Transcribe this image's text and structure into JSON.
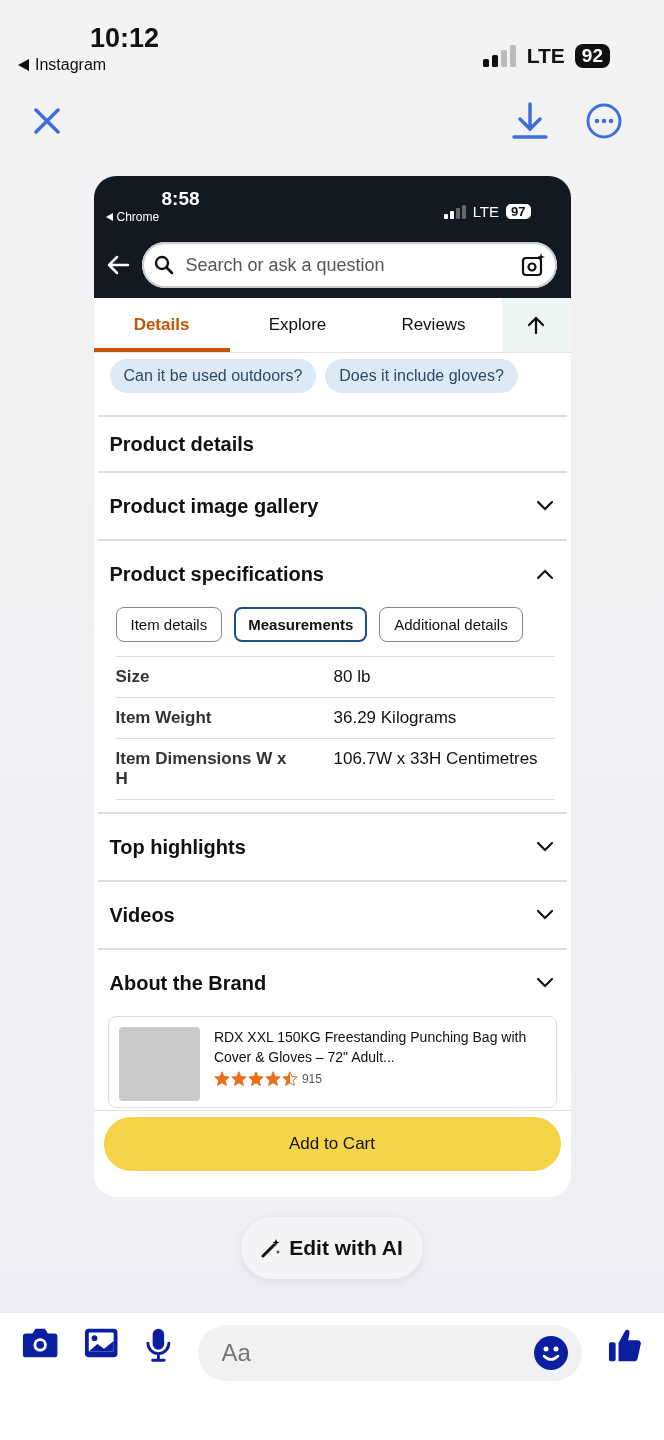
{
  "status_bar": {
    "time": "10:12",
    "back_label": "Instagram",
    "network": "LTE",
    "battery": "92"
  },
  "screenshot": {
    "status_bar": {
      "time": "8:58",
      "back_label": "Chrome",
      "network": "LTE",
      "battery": "97"
    },
    "search": {
      "placeholder": "Search or ask a question"
    },
    "tabs": [
      {
        "label": "Details",
        "selected": true
      },
      {
        "label": "Explore",
        "selected": false
      },
      {
        "label": "Reviews",
        "selected": false
      }
    ],
    "question_chips": [
      "Can it be used outdoors?",
      "Does it include gloves?"
    ],
    "sections": [
      {
        "kind": "heading",
        "title": "Product details"
      },
      {
        "kind": "accordion",
        "title": "Product image gallery",
        "expanded": false
      },
      {
        "kind": "accordion",
        "title": "Product specifications",
        "expanded": true,
        "spec_tabs": [
          {
            "label": "Item details",
            "selected": false
          },
          {
            "label": "Measurements",
            "selected": true
          },
          {
            "label": "Additional details",
            "selected": false
          }
        ],
        "specs": [
          {
            "label": "Size",
            "value": "80 lb"
          },
          {
            "label": "Item Weight",
            "value": "36.29 Kilograms"
          },
          {
            "label": "Item Dimensions W x H",
            "value": "106.7W x 33H Centimetres"
          }
        ]
      },
      {
        "kind": "accordion",
        "title": "Top highlights",
        "expanded": false
      },
      {
        "kind": "accordion",
        "title": "Videos",
        "expanded": false
      },
      {
        "kind": "accordion",
        "title": "About the Brand",
        "expanded": false
      }
    ],
    "product": {
      "title": "RDX XXL 150KG Freestanding Punching Bag with Cover & Gloves – 72\" Adult...",
      "stars": 4.5,
      "rating_count": "915"
    },
    "cart_button": "Add to Cart"
  },
  "edit_button": "Edit with AI",
  "composer": {
    "placeholder": "Aa"
  }
}
